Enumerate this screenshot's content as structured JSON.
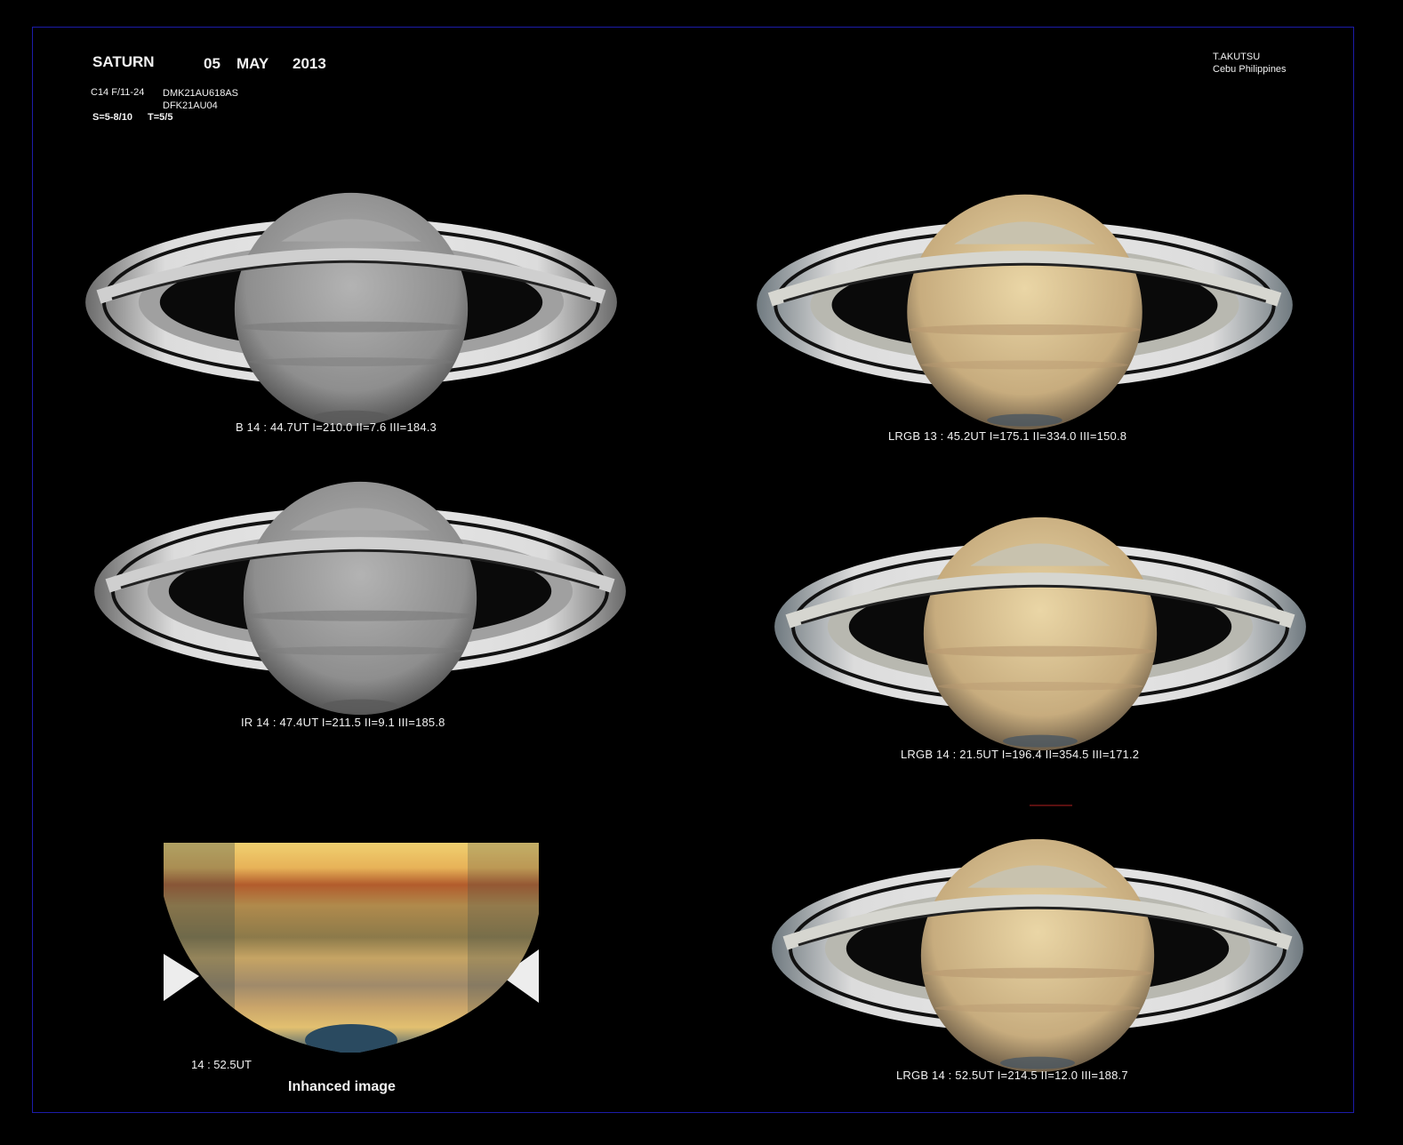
{
  "header": {
    "object": "SATURN",
    "day": "05",
    "month": "MAY",
    "year": "2013",
    "telescope": "C14  F/11-24",
    "camera1": "DMK21AU618AS",
    "camera2": "DFK21AU04",
    "seeing": "S=5-8/10",
    "transparency": "T=5/5",
    "author": "T.AKUTSU",
    "location": "Cebu  Philippines"
  },
  "panels": [
    {
      "id": "b",
      "caption": "B   14 : 44.7UT   I=210.0   II=7.6   III=184.3",
      "palette": "mono"
    },
    {
      "id": "ir",
      "caption": "IR   14 : 47.4UT   I=211.5   II=9.1   III=185.8",
      "palette": "mono"
    },
    {
      "id": "lrgb1",
      "caption": "LRGB   13 : 45.2UT   I=175.1   II=334.0   III=150.8",
      "palette": "color"
    },
    {
      "id": "lrgb2",
      "caption": "LRGB  14 : 21.5UT   I=196.4   II=354.5   III=171.2",
      "palette": "color"
    },
    {
      "id": "lrgb3",
      "caption": "LRGB   14 : 52.5UT   I=214.5   II=12.0   III=188.7",
      "palette": "color"
    }
  ],
  "enhanced": {
    "time": "14 : 52.5UT",
    "label": "Inhanced image"
  },
  "colors": {
    "frame": "#1c1caa",
    "mono_globe": "#9a9a9a",
    "color_globe": "#d8c39a",
    "ring_light": "#e6e6e6"
  }
}
